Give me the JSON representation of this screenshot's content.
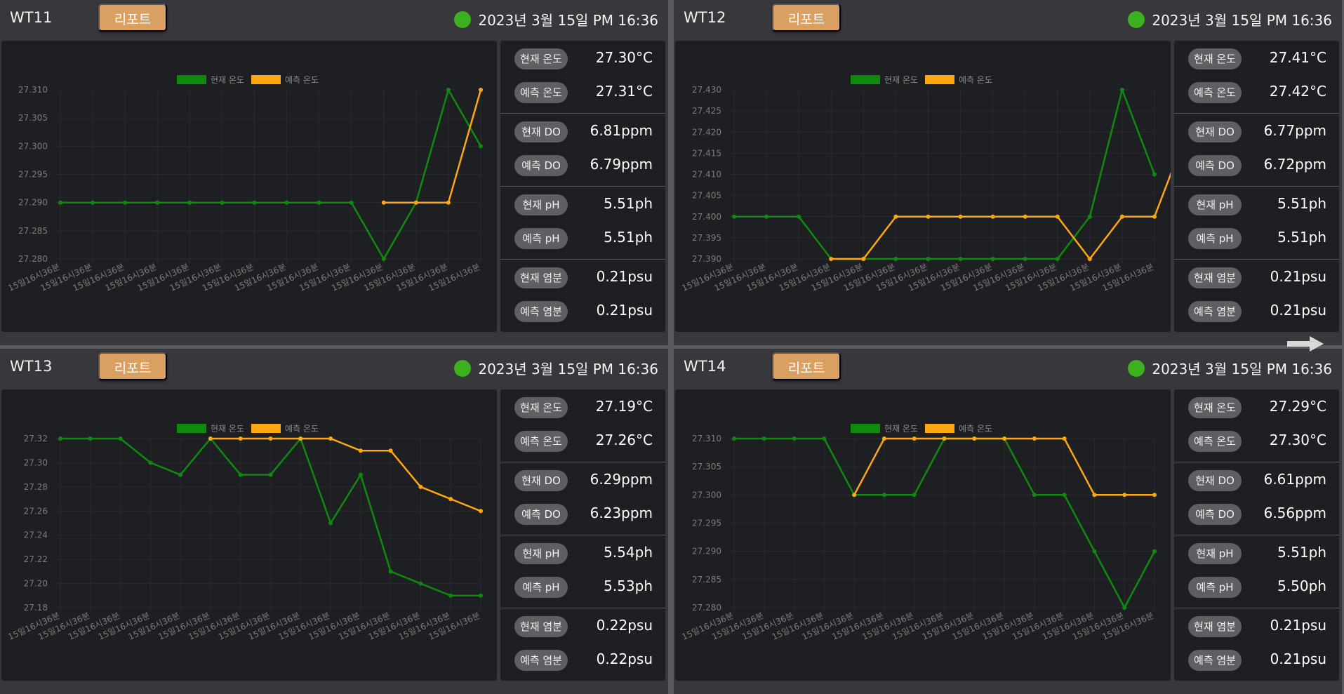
{
  "colors": {
    "current": "#0f8a0f",
    "predicted": "#ffa712",
    "status_ok": "#3cb01e",
    "report": "#d9a062"
  },
  "icons": {
    "status": "status-dot-icon",
    "next": "arrow-right-icon"
  },
  "panels": [
    {
      "name": "WT11",
      "report_label": "리포트",
      "datetime": "2023년 3월 15일 PM 16:36",
      "metrics": [
        {
          "cur_label": "현재 온도",
          "cur_value": "27.30°C",
          "pred_label": "예측 온도",
          "pred_value": "27.31°C"
        },
        {
          "cur_label": "현재 DO",
          "cur_value": "6.81ppm",
          "pred_label": "예측 DO",
          "pred_value": "6.79ppm"
        },
        {
          "cur_label": "현재 pH",
          "cur_value": "5.51ph",
          "pred_label": "예측 pH",
          "pred_value": "5.51ph"
        },
        {
          "cur_label": "현재 염분",
          "cur_value": "0.21psu",
          "pred_label": "예측 염분",
          "pred_value": "0.21psu"
        }
      ],
      "chart_data": {
        "type": "line",
        "legend": [
          "현재 온도",
          "예측 온도"
        ],
        "legend_position": "top-center",
        "grid": true,
        "categories": [
          "15일16시36분",
          "15일16시36분",
          "15일16시36분",
          "15일16시36분",
          "15일16시36분",
          "15일16시36분",
          "15일16시36분",
          "15일16시36분",
          "15일16시36분",
          "15일16시36분",
          "15일16시36분",
          "15일16시36분",
          "15일16시36분",
          "15일16시36분"
        ],
        "yticks": [
          "27.310",
          "27.305",
          "27.300",
          "27.295",
          "27.290",
          "27.285",
          "27.280"
        ],
        "ylim": [
          27.28,
          27.31
        ],
        "series": [
          {
            "name": "현재 온도",
            "start": 0,
            "values": [
              27.29,
              27.29,
              27.29,
              27.29,
              27.29,
              27.29,
              27.29,
              27.29,
              27.29,
              27.29,
              27.28,
              27.29,
              27.31,
              27.3
            ]
          },
          {
            "name": "예측 온도",
            "start": 10,
            "values": [
              27.29,
              27.29,
              27.29,
              27.31
            ]
          }
        ]
      }
    },
    {
      "name": "WT12",
      "report_label": "리포트",
      "datetime": "2023년 3월 15일 PM 16:36",
      "metrics": [
        {
          "cur_label": "현재 온도",
          "cur_value": "27.41°C",
          "pred_label": "예측 온도",
          "pred_value": "27.42°C"
        },
        {
          "cur_label": "현재 DO",
          "cur_value": "6.77ppm",
          "pred_label": "예측 DO",
          "pred_value": "6.72ppm"
        },
        {
          "cur_label": "현재 pH",
          "cur_value": "5.51ph",
          "pred_label": "예측 pH",
          "pred_value": "5.51ph"
        },
        {
          "cur_label": "현재 염분",
          "cur_value": "0.21psu",
          "pred_label": "예측 염분",
          "pred_value": "0.21psu"
        }
      ],
      "chart_data": {
        "type": "line",
        "legend": [
          "현재 온도",
          "예측 온도"
        ],
        "legend_position": "top-center",
        "grid": true,
        "categories": [
          "15일16시36분",
          "15일16시36분",
          "15일16시36분",
          "15일16시36분",
          "15일16시36분",
          "15일16시36분",
          "15일16시36분",
          "15일16시36분",
          "15일16시36분",
          "15일16시36분",
          "15일16시36분",
          "15일16시36분",
          "15일16시36분",
          "15일16시36분"
        ],
        "yticks": [
          "27.430",
          "27.425",
          "27.420",
          "27.415",
          "27.410",
          "27.405",
          "27.400",
          "27.395",
          "27.390"
        ],
        "ylim": [
          27.39,
          27.43
        ],
        "series": [
          {
            "name": "현재 온도",
            "start": 0,
            "values": [
              27.4,
              27.4,
              27.4,
              27.39,
              27.39,
              27.39,
              27.39,
              27.39,
              27.39,
              27.39,
              27.39,
              27.4,
              27.43,
              27.41
            ]
          },
          {
            "name": "예측 온도",
            "start": 3,
            "values": [
              27.39,
              27.39,
              27.4,
              27.4,
              27.4,
              27.4,
              27.4,
              27.4,
              27.39,
              27.4,
              27.4,
              27.42
            ]
          }
        ]
      }
    },
    {
      "name": "WT13",
      "report_label": "리포트",
      "datetime": "2023년 3월 15일 PM 16:36",
      "metrics": [
        {
          "cur_label": "현재 온도",
          "cur_value": "27.19°C",
          "pred_label": "예측 온도",
          "pred_value": "27.26°C"
        },
        {
          "cur_label": "현재 DO",
          "cur_value": "6.29ppm",
          "pred_label": "예측 DO",
          "pred_value": "6.23ppm"
        },
        {
          "cur_label": "현재 pH",
          "cur_value": "5.54ph",
          "pred_label": "예측 pH",
          "pred_value": "5.53ph"
        },
        {
          "cur_label": "현재 염분",
          "cur_value": "0.22psu",
          "pred_label": "예측 염분",
          "pred_value": "0.22psu"
        }
      ],
      "chart_data": {
        "type": "line",
        "legend": [
          "현재 온도",
          "예측 온도"
        ],
        "legend_position": "top-center",
        "grid": true,
        "categories": [
          "15일16시36분",
          "15일16시36분",
          "15일16시36분",
          "15일16시36분",
          "15일16시36분",
          "15일16시36분",
          "15일16시36분",
          "15일16시36분",
          "15일16시36분",
          "15일16시36분",
          "15일16시36분",
          "15일16시36분",
          "15일16시36분",
          "15일16시36분",
          "15일16시36분"
        ],
        "yticks": [
          "27.32",
          "27.30",
          "27.28",
          "27.26",
          "27.24",
          "27.22",
          "27.20",
          "27.18"
        ],
        "ylim": [
          27.18,
          27.32
        ],
        "series": [
          {
            "name": "현재 온도",
            "start": 0,
            "values": [
              27.32,
              27.32,
              27.32,
              27.3,
              27.29,
              27.32,
              27.29,
              27.29,
              27.32,
              27.25,
              27.29,
              27.21,
              27.2,
              27.19,
              27.19
            ]
          },
          {
            "name": "예측 온도",
            "start": 5,
            "values": [
              27.32,
              27.32,
              27.32,
              27.32,
              27.32,
              27.31,
              27.31,
              27.28,
              27.27,
              27.26
            ]
          }
        ]
      }
    },
    {
      "name": "WT14",
      "report_label": "리포트",
      "datetime": "2023년 3월 15일 PM 16:36",
      "metrics": [
        {
          "cur_label": "현재 온도",
          "cur_value": "27.29°C",
          "pred_label": "예측 온도",
          "pred_value": "27.30°C"
        },
        {
          "cur_label": "현재 DO",
          "cur_value": "6.61ppm",
          "pred_label": "예측 DO",
          "pred_value": "6.56ppm"
        },
        {
          "cur_label": "현재 pH",
          "cur_value": "5.51ph",
          "pred_label": "예측 pH",
          "pred_value": "5.50ph"
        },
        {
          "cur_label": "현재 염분",
          "cur_value": "0.21psu",
          "pred_label": "예측 염분",
          "pred_value": "0.21psu"
        }
      ],
      "chart_data": {
        "type": "line",
        "legend": [
          "현재 온도",
          "예측 온도"
        ],
        "legend_position": "top-center",
        "grid": true,
        "categories": [
          "15일16시36분",
          "15일16시36분",
          "15일16시36분",
          "15일16시36분",
          "15일16시36분",
          "15일16시36분",
          "15일16시36분",
          "15일16시36분",
          "15일16시36분",
          "15일16시36분",
          "15일16시36분",
          "15일16시36분",
          "15일16시36분",
          "15일16시36분",
          "15일16시36분"
        ],
        "yticks": [
          "27.310",
          "27.305",
          "27.300",
          "27.295",
          "27.290",
          "27.285",
          "27.280"
        ],
        "ylim": [
          27.28,
          27.31
        ],
        "series": [
          {
            "name": "현재 온도",
            "start": 0,
            "values": [
              27.31,
              27.31,
              27.31,
              27.31,
              27.3,
              27.3,
              27.3,
              27.31,
              27.31,
              27.31,
              27.3,
              27.3,
              27.29,
              27.28,
              27.29
            ]
          },
          {
            "name": "예측 온도",
            "start": 4,
            "values": [
              27.3,
              27.31,
              27.31,
              27.31,
              27.31,
              27.31,
              27.31,
              27.31,
              27.3,
              27.3,
              27.3
            ]
          }
        ]
      }
    }
  ]
}
